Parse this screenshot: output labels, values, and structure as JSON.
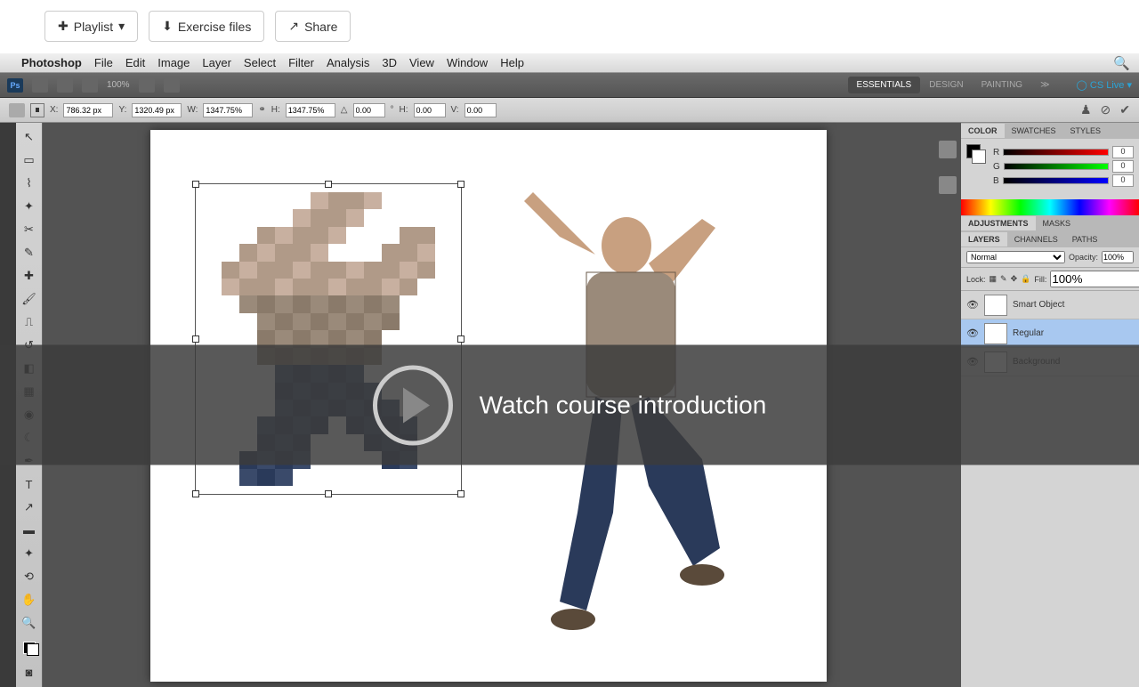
{
  "topbar": {
    "playlist": "Playlist",
    "exercise": "Exercise files",
    "share": "Share"
  },
  "menubar": {
    "app": "Photoshop",
    "items": [
      "File",
      "Edit",
      "Image",
      "Layer",
      "Select",
      "Filter",
      "Analysis",
      "3D",
      "View",
      "Window",
      "Help"
    ]
  },
  "appbar": {
    "zoom": "100%",
    "workspaces": [
      "ESSENTIALS",
      "DESIGN",
      "PAINTING"
    ],
    "more": "≫",
    "cslive": "CS Live ▾"
  },
  "options": {
    "x_label": "X:",
    "x": "786.32 px",
    "y_label": "Y:",
    "y": "1320.49 px",
    "w_label": "W:",
    "w": "1347.75%",
    "h_label": "H:",
    "h": "1347.75%",
    "angle_label": "△",
    "angle": "0.00",
    "deg": "°",
    "hskew_label": "H:",
    "hskew": "0.00",
    "vskew_label": "V:",
    "vskew": "0.00"
  },
  "panels": {
    "color": {
      "tabs": [
        "COLOR",
        "SWATCHES",
        "STYLES"
      ],
      "r": "R",
      "g": "G",
      "b": "B",
      "rv": "0",
      "gv": "0",
      "bv": "0"
    },
    "adj": {
      "tabs": [
        "ADJUSTMENTS",
        "MASKS"
      ]
    },
    "layers": {
      "tabs": [
        "LAYERS",
        "CHANNELS",
        "PATHS"
      ],
      "blend": "Normal",
      "opacity_label": "Opacity:",
      "opacity": "100%",
      "lock_label": "Lock:",
      "fill_label": "Fill:",
      "fill": "100%",
      "items": [
        {
          "name": "Smart Object"
        },
        {
          "name": "Regular"
        },
        {
          "name": "Background"
        }
      ]
    }
  },
  "overlay": {
    "text": "Watch course introduction"
  }
}
